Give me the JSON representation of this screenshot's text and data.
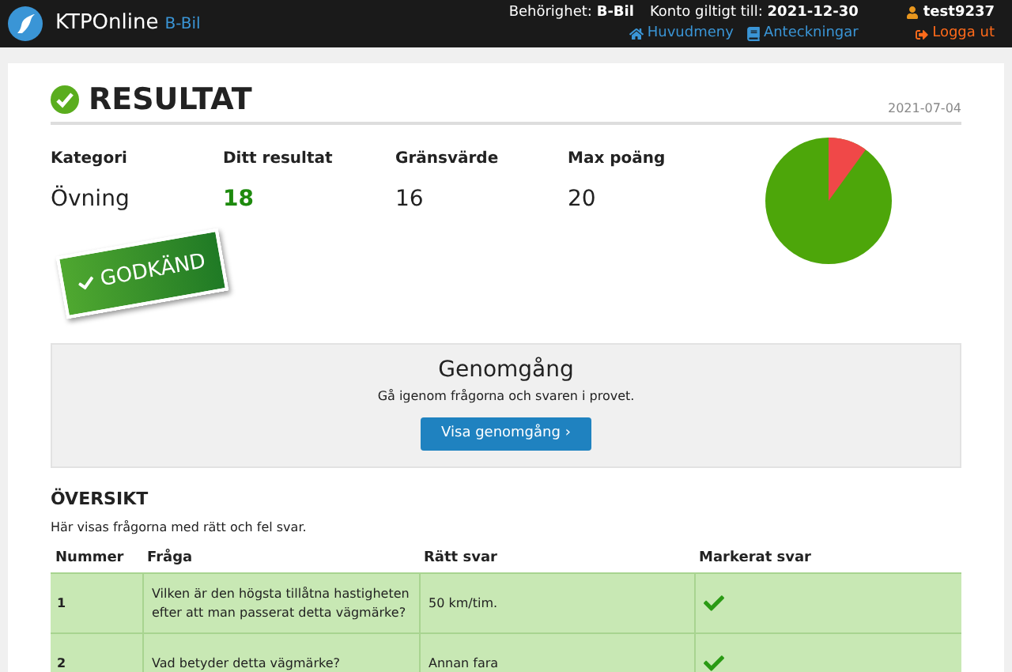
{
  "header": {
    "brand": "KTPOnline",
    "brand_sub": "B-Bil",
    "permission_label": "Behörighet:",
    "permission_value": "B-Bil",
    "account_label": "Konto giltigt till:",
    "account_value": "2021-12-30",
    "user": "test9237",
    "links": [
      {
        "kind": "home",
        "label": "Huvudmeny"
      },
      {
        "kind": "notes",
        "label": "Anteckningar"
      }
    ],
    "logout": "Logga ut"
  },
  "result": {
    "title": "RESULTAT",
    "date": "2021-07-04",
    "stats": [
      {
        "label": "Kategori",
        "value": "Övning",
        "highlight": false
      },
      {
        "label": "Ditt resultat",
        "value": "18",
        "highlight": true
      },
      {
        "label": "Gränsvärde",
        "value": "16",
        "highlight": false
      },
      {
        "label": "Max poäng",
        "value": "20",
        "highlight": false
      }
    ],
    "stamp": "GODKÄND"
  },
  "review": {
    "title": "Genomgång",
    "text": "Gå igenom frågorna och svaren i provet.",
    "button": "Visa genomgång",
    "button_icon": "›"
  },
  "overview": {
    "title": "ÖVERSIKT",
    "text": "Här visas frågorna med rätt och fel svar.",
    "columns": [
      "Nummer",
      "Fråga",
      "Rätt svar",
      "Markerat svar"
    ],
    "rows": [
      {
        "number": "1",
        "question": "Vilken är den högsta tillåtna hastigheten efter att man passerat detta vägmärke?",
        "answer": "50 km/tim.",
        "correct": true
      },
      {
        "number": "2",
        "question": "Vad betyder detta vägmärke?",
        "answer": "Annan fara",
        "correct": true
      }
    ]
  }
}
